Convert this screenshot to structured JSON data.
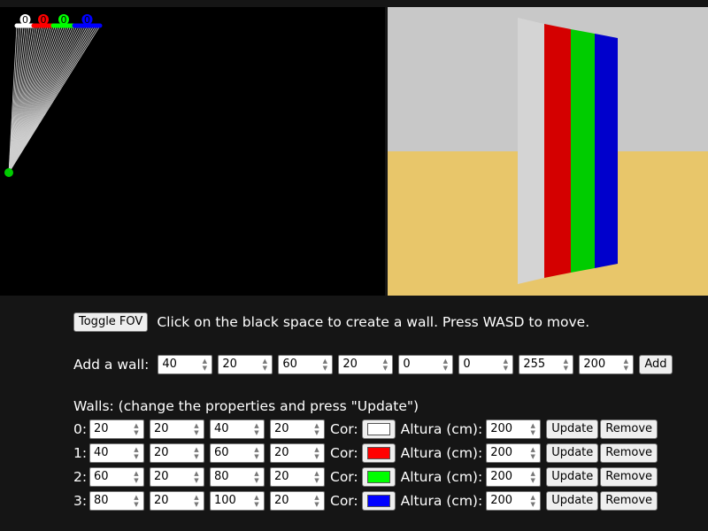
{
  "colors": {
    "wall0": "#ffffff",
    "wall1": "#ff0000",
    "wall2": "#00ff00",
    "wall3": "#0000ff",
    "sky": "#c8c8c8",
    "floor": "#e8c66a",
    "player": "#00cc00"
  },
  "map": {
    "wall_labels": [
      "0",
      "0",
      "0",
      "0"
    ]
  },
  "toolbar": {
    "toggle_fov_label": "Toggle FOV",
    "info_text": "Click on the black space to create a wall. Press WASD to move."
  },
  "add_wall": {
    "label": "Add a wall:",
    "values": [
      "40",
      "20",
      "60",
      "20",
      "0",
      "0",
      "255",
      "200"
    ],
    "add_label": "Add"
  },
  "walls_section": {
    "title": "Walls: (change the properties and press \"Update\")",
    "cor_label": "Cor:",
    "altura_label": "Altura (cm):",
    "update_label": "Update",
    "remove_label": "Remove",
    "rows": [
      {
        "index": "0:",
        "x1": "20",
        "y1": "20",
        "x2": "40",
        "y2": "20",
        "color": "#ffffff",
        "height": "200"
      },
      {
        "index": "1:",
        "x1": "40",
        "y1": "20",
        "x2": "60",
        "y2": "20",
        "color": "#ff0000",
        "height": "200"
      },
      {
        "index": "2:",
        "x1": "60",
        "y1": "20",
        "x2": "80",
        "y2": "20",
        "color": "#00ff00",
        "height": "200"
      },
      {
        "index": "3:",
        "x1": "80",
        "y1": "20",
        "x2": "100",
        "y2": "20",
        "color": "#0000ff",
        "height": "200"
      }
    ]
  }
}
